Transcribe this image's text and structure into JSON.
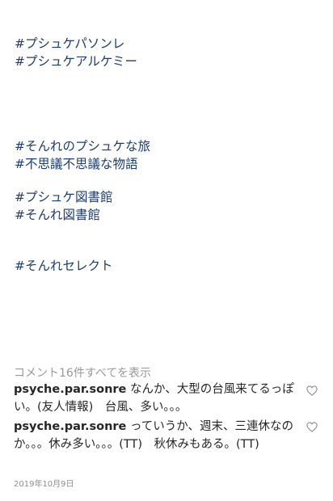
{
  "caption": {
    "hashtags_group1": [
      "#プシュケパソンレ",
      "#プシュケアルケミー"
    ],
    "hashtags_group2": [
      "#そんれのプシュケな旅",
      "#不思議不思議な物語"
    ],
    "hashtags_group3": [
      "#プシュケ図書館",
      "#そんれ図書館"
    ],
    "hashtags_group4": [
      "#そんれセレクト"
    ]
  },
  "view_all_comments": "コメント16件すべてを表示",
  "comments": [
    {
      "username": "psyche.par.sonre",
      "text": "なんか、大型の台風来てるっぽい。(友人情報)　台風、多い。。。"
    },
    {
      "username": "psyche.par.sonre",
      "text": "っていうか、週末、三連休なのか。。。休み多い。。。(TT)　秋休みもある。(TT)"
    }
  ],
  "timestamp": "2019年10月9日",
  "colors": {
    "hashtag": "#1f3c6e",
    "text": "#262626",
    "muted": "#999999",
    "icon": "#8e8e8e"
  },
  "icons": {
    "like": "heart-outline-icon"
  }
}
